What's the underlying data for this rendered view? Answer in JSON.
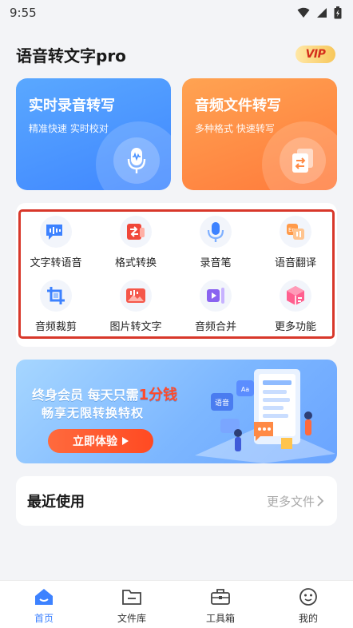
{
  "status_bar": {
    "time": "9:55"
  },
  "header": {
    "app_title": "语音转文字pro",
    "vip_label": "VIP"
  },
  "hero": {
    "realtime": {
      "title": "实时录音转写",
      "subtitle": "精准快速 实时校对"
    },
    "file": {
      "title": "音频文件转写",
      "subtitle": "多种格式 快速转写"
    }
  },
  "tools": [
    {
      "label": "文字转语音",
      "icon": "text-to-speech-icon"
    },
    {
      "label": "格式转换",
      "icon": "format-convert-icon"
    },
    {
      "label": "录音笔",
      "icon": "microphone-icon"
    },
    {
      "label": "语音翻译",
      "icon": "voice-translate-icon"
    },
    {
      "label": "音频裁剪",
      "icon": "audio-crop-icon"
    },
    {
      "label": "图片转文字",
      "icon": "image-to-text-icon"
    },
    {
      "label": "音频合并",
      "icon": "audio-merge-icon"
    },
    {
      "label": "更多功能",
      "icon": "more-functions-icon"
    }
  ],
  "banner": {
    "line1_prefix": "终身会员 每天只需",
    "line1_highlight": "1分钱",
    "line2": "畅享无限转换特权",
    "button_label": "立即体验",
    "card_labels": [
      "语音",
      "Aa"
    ]
  },
  "recent": {
    "title": "最近使用",
    "more_label": "更多文件"
  },
  "bottom_nav": [
    {
      "label": "首页",
      "icon": "home-icon",
      "active": true
    },
    {
      "label": "文件库",
      "icon": "folder-icon",
      "active": false
    },
    {
      "label": "工具箱",
      "icon": "toolbox-icon",
      "active": false
    },
    {
      "label": "我的",
      "icon": "profile-icon",
      "active": false
    }
  ],
  "colors": {
    "accent": "#3d82ff",
    "hero_blue": "#4a92ff",
    "hero_orange": "#ff8a45",
    "highlight_border": "#d8372a",
    "banner_button": "#ff5a2e"
  }
}
